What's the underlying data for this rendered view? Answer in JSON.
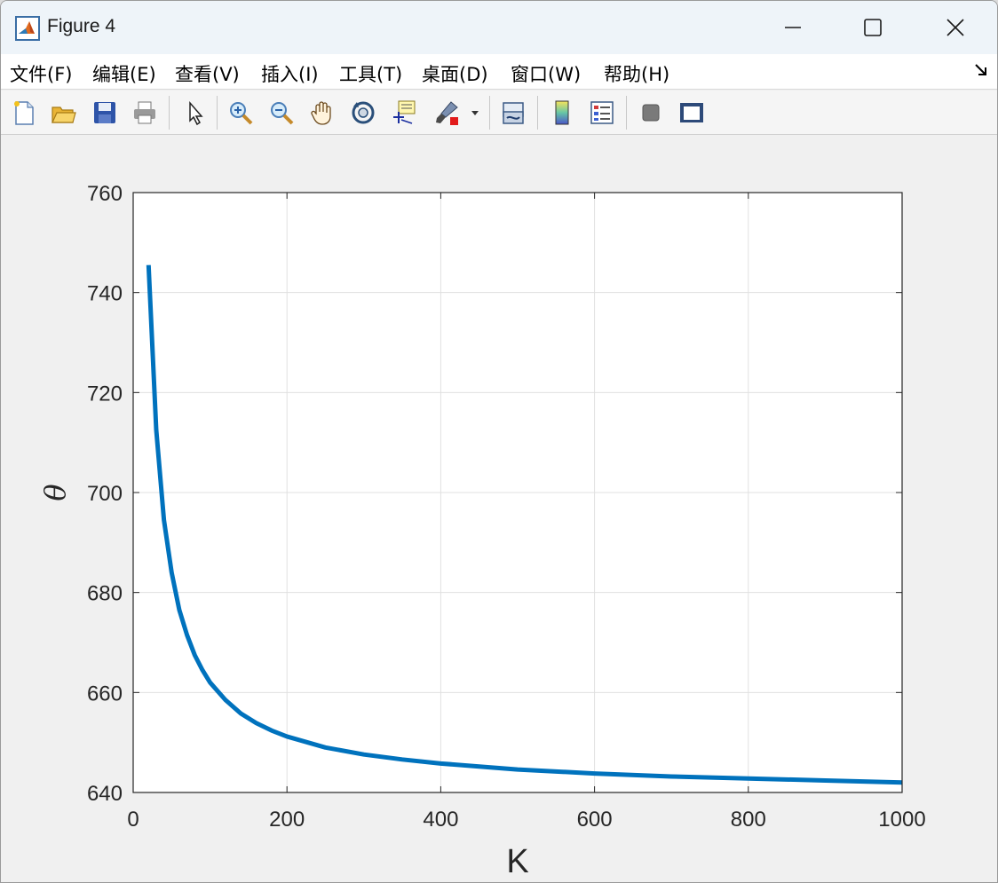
{
  "window": {
    "title": "Figure 4"
  },
  "menu": {
    "items": [
      {
        "label": "文件(F)"
      },
      {
        "label": "编辑(E)"
      },
      {
        "label": "查看(V)"
      },
      {
        "label": "插入(I)"
      },
      {
        "label": "工具(T)"
      },
      {
        "label": "桌面(D)"
      },
      {
        "label": "窗口(W)"
      },
      {
        "label": "帮助(H)"
      }
    ]
  },
  "toolbar": {
    "buttons": [
      "new-figure-icon",
      "open-file-icon",
      "save-icon",
      "print-icon",
      "select-arrow-icon",
      "zoom-in-icon",
      "zoom-out-icon",
      "pan-hand-icon",
      "rotate-3d-icon",
      "data-cursor-icon",
      "brush-icon",
      "link-plot-icon",
      "colorbar-icon",
      "legend-icon",
      "hide-plot-tools-icon",
      "show-plot-tools-icon"
    ]
  },
  "colors": {
    "line": "#0072BD",
    "grid": "#e0e0e0",
    "axes": "#262626"
  },
  "chart_data": {
    "type": "line",
    "xlabel": "K",
    "ylabel": "θ",
    "xlim": [
      0,
      1000
    ],
    "ylim": [
      640,
      760
    ],
    "xticks": [
      "0",
      "200",
      "400",
      "600",
      "800",
      "1000"
    ],
    "yticks": [
      "640",
      "660",
      "680",
      "700",
      "720",
      "740",
      "760"
    ],
    "grid": true,
    "series": [
      {
        "x": [
          20,
          30,
          40,
          50,
          60,
          70,
          80,
          90,
          100,
          120,
          140,
          160,
          180,
          200,
          250,
          300,
          350,
          400,
          450,
          500,
          600,
          700,
          800,
          900,
          1000
        ],
        "y": [
          745.5,
          712.5,
          694.5,
          684.0,
          676.5,
          671.5,
          667.5,
          664.5,
          662.0,
          658.5,
          655.8,
          653.9,
          652.4,
          651.2,
          649.0,
          647.6,
          646.6,
          645.8,
          645.2,
          644.6,
          643.8,
          643.2,
          642.8,
          642.4,
          642.0
        ]
      }
    ]
  }
}
